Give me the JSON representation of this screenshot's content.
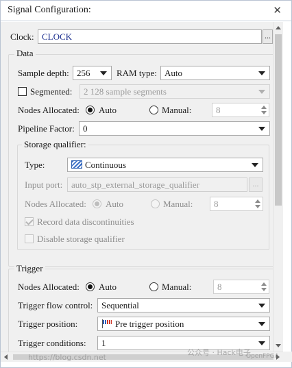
{
  "window": {
    "title": "Signal Configuration:",
    "close_glyph": "✕"
  },
  "clock": {
    "label": "Clock:",
    "value": "CLOCK",
    "browse": "..."
  },
  "data": {
    "group_title": "Data",
    "sample_depth_label": "Sample depth:",
    "sample_depth_value": "256",
    "ram_type_label": "RAM type:",
    "ram_type_value": "Auto",
    "segmented_label": "Segmented:",
    "segmented_checked": false,
    "segments_value": "2  128 sample segments",
    "nodes_allocated_label": "Nodes Allocated:",
    "auto_label": "Auto",
    "manual_label": "Manual:",
    "nodes_value": "8",
    "pipeline_label": "Pipeline Factor:",
    "pipeline_value": "0"
  },
  "storage_qualifier": {
    "group_title": "Storage qualifier:",
    "type_label": "Type:",
    "type_value": "Continuous",
    "type_icon": "continuous-icon",
    "input_port_label": "Input port:",
    "input_port_value": "auto_stp_external_storage_qualifier",
    "browse": "...",
    "nodes_allocated_label": "Nodes Allocated:",
    "auto_label": "Auto",
    "manual_label": "Manual:",
    "nodes_value": "8",
    "record_label": "Record data discontinuities",
    "record_checked": true,
    "disable_label": "Disable storage qualifier",
    "disable_checked": false
  },
  "trigger": {
    "group_title": "Trigger",
    "nodes_allocated_label": "Nodes Allocated:",
    "auto_label": "Auto",
    "manual_label": "Manual:",
    "nodes_value": "8",
    "flow_control_label": "Trigger flow control:",
    "flow_control_value": "Sequential",
    "position_label": "Trigger position:",
    "position_value": "Pre trigger position",
    "position_icon": "pre-trigger-flag-icon",
    "conditions_label": "Trigger conditions:",
    "conditions_value": "1"
  },
  "watermark": {
    "url": "https://blog.csdn.net",
    "brand": "公众号 · Hack电子",
    "corner": "OpenFPGA"
  }
}
